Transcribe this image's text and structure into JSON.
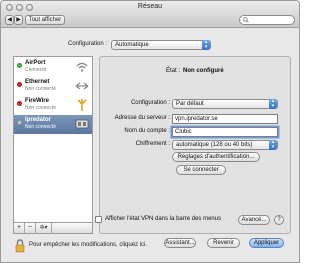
{
  "window": {
    "title": "Réseau"
  },
  "toolbar": {
    "show_all_label": "Tout afficher"
  },
  "configuration": {
    "label": "Configuration :",
    "value": "Automatique"
  },
  "services": [
    {
      "name": "AirPort",
      "status": "Connecté",
      "dot_color": "#3fbf3f",
      "icon": "wifi-icon"
    },
    {
      "name": "Ethernet",
      "status": "Non connecté",
      "dot_color": "#d42a2a",
      "icon": "ethernet-icon"
    },
    {
      "name": "FireWire",
      "status": "Non connecté",
      "dot_color": "#d42a2a",
      "icon": "firewire-icon"
    },
    {
      "name": "Ipredator",
      "status": "Non connecté",
      "dot_color": "#c9c9c9",
      "icon": "vpn-icon",
      "selected": true
    }
  ],
  "list_tools": {
    "add": "+",
    "remove": "−",
    "gear": "✲▾"
  },
  "detail": {
    "status_label": "État :",
    "status_value": "Non configuré",
    "config_label": "Configuration :",
    "config_value": "Par défaut",
    "server_label": "Adresse du serveur :",
    "server_value": "vpn.ipredator.se",
    "account_label": "Nom du compte :",
    "account_value": "Clubic",
    "encryption_label": "Chiffrement :",
    "encryption_value": "automatique (128 ou 40 bits)",
    "auth_button": "Réglages d'authentification...",
    "connect_button": "Se connecter",
    "show_vpn_label": "Afficher l'état VPN dans la barre des menus",
    "advanced_button": "Avancé...",
    "help": "?"
  },
  "footer": {
    "lock_text": "Pour empêcher les modifications, cliquez ici.",
    "assistant_button": "Assistant...",
    "revert_button": "Revenir",
    "apply_button": "Appliquer"
  },
  "colors": {
    "accent": "#3a7bd5",
    "selection": "#5f7ba5"
  }
}
